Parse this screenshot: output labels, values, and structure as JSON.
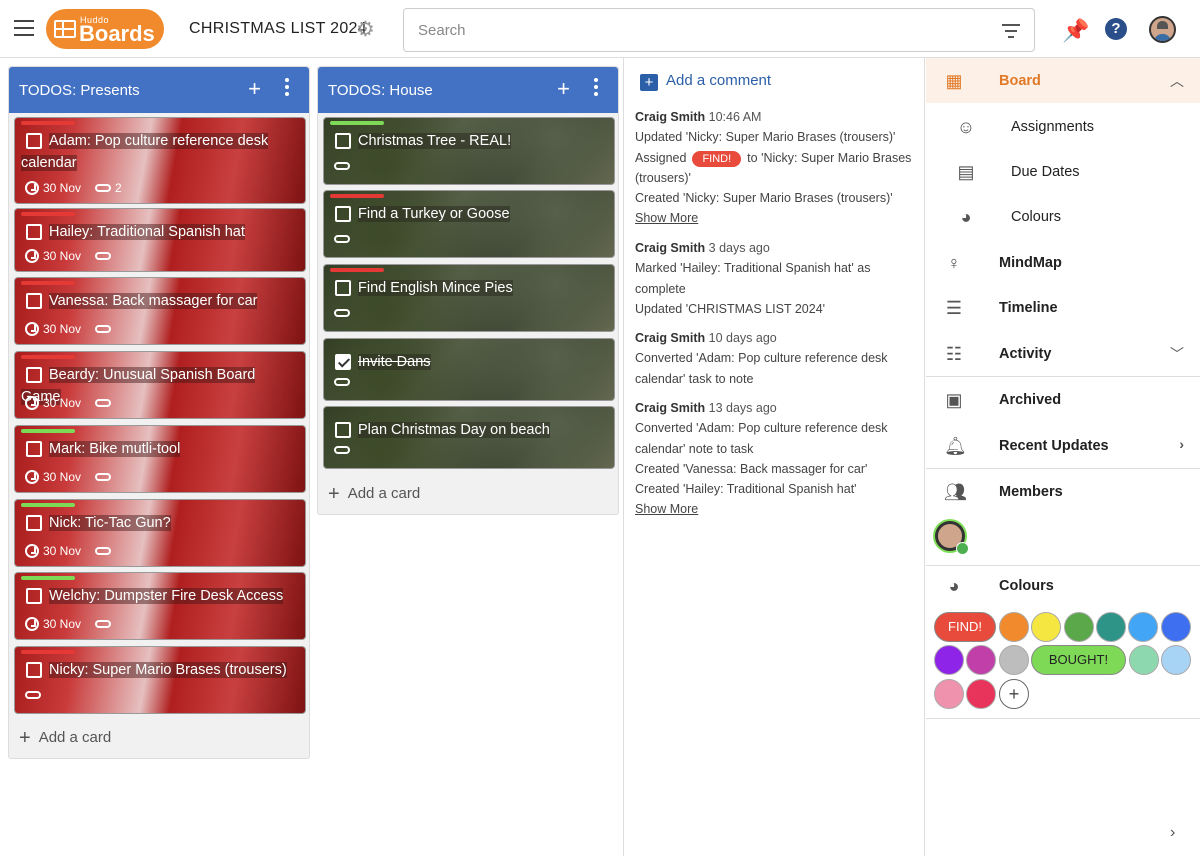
{
  "app": {
    "logo_small": "Huddo",
    "logo_big": "Boards",
    "board_title": "CHRISTMAS LIST 2024"
  },
  "search": {
    "placeholder": "Search"
  },
  "lists": [
    {
      "title": "TODOS: Presents",
      "add_card_label": "Add a card",
      "cards": [
        {
          "title": "Adam: Pop culture reference desk calendar",
          "tag_color": "#e53935",
          "due": "30 Nov",
          "links": "2",
          "checked": false
        },
        {
          "title": "Hailey: Traditional Spanish hat",
          "tag_color": "#e53935",
          "due": "30 Nov",
          "links": "",
          "checked": false
        },
        {
          "title": "Vanessa: Back massager for car",
          "tag_color": "#e53935",
          "due": "30 Nov",
          "links": "",
          "checked": false
        },
        {
          "title": "Beardy: Unusual Spanish Board Game",
          "tag_color": "#e53935",
          "due": "30 Nov",
          "links": "",
          "checked": false
        },
        {
          "title": "Mark: Bike mutli-tool",
          "tag_color": "#7ed957",
          "due": "30 Nov",
          "links": "",
          "checked": false
        },
        {
          "title": "Nick: Tic-Tac Gun?",
          "tag_color": "#7ed957",
          "due": "30 Nov",
          "links": "",
          "checked": false
        },
        {
          "title": "Welchy: Dumpster Fire Desk Access",
          "tag_color": "#7ed957",
          "due": "30 Nov",
          "links": "",
          "checked": false
        },
        {
          "title": "Nicky: Super Mario Brases (trousers)",
          "tag_color": "#e53935",
          "due": "",
          "links": "",
          "checked": false
        }
      ]
    },
    {
      "title": "TODOS: House",
      "add_card_label": "Add a card",
      "cards": [
        {
          "title": "Christmas Tree - REAL!",
          "tag_color": "#7ed957",
          "checked": false
        },
        {
          "title": "Find a Turkey or Goose",
          "tag_color": "#e53935",
          "checked": false
        },
        {
          "title": "Find English Mince Pies",
          "tag_color": "#e53935",
          "checked": false
        },
        {
          "title": "Invite Dans",
          "tag_color": "",
          "checked": true
        },
        {
          "title": "Plan Christmas Day on beach",
          "tag_color": "",
          "checked": false
        }
      ]
    }
  ],
  "comments": {
    "add_label": "Add a comment",
    "entries": [
      {
        "who": "Craig Smith",
        "time": "10:46 AM",
        "lines": [
          "Updated 'Nicky: Super Mario Brases (trousers)'",
          "Assigned",
          "FIND!",
          "to 'Nicky: Super Mario Brases (trousers)'",
          "Created 'Nicky: Super Mario Brases (trousers)'"
        ],
        "more": "Show More"
      },
      {
        "who": "Craig Smith",
        "time": "3 days ago",
        "lines": [
          "Marked 'Hailey: Traditional Spanish hat' as complete",
          "Updated 'CHRISTMAS LIST 2024'"
        ]
      },
      {
        "who": "Craig Smith",
        "time": "10 days ago",
        "lines": [
          "Converted 'Adam: Pop culture reference desk calendar' task to note"
        ]
      },
      {
        "who": "Craig Smith",
        "time": "13 days ago",
        "lines": [
          "Converted 'Adam: Pop culture reference desk calendar' note to task",
          "Created 'Vanessa: Back massager for car'",
          "Created 'Hailey: Traditional Spanish hat'"
        ],
        "more": "Show More"
      }
    ]
  },
  "sidebar": {
    "board": "Board",
    "assignments": "Assignments",
    "due_dates": "Due Dates",
    "colours_sub": "Colours",
    "mindmap": "MindMap",
    "timeline": "Timeline",
    "activity": "Activity",
    "archived": "Archived",
    "recent_updates": "Recent Updates",
    "members": "Members",
    "colours": "Colours",
    "palette": [
      {
        "label": "FIND!",
        "color": "#e84b3c"
      },
      {
        "label": "",
        "color": "#f08a2c"
      },
      {
        "label": "",
        "color": "#f5e642"
      },
      {
        "label": "",
        "color": "#5aa84a"
      },
      {
        "label": "",
        "color": "#2e9487"
      },
      {
        "label": "",
        "color": "#42a5f5"
      },
      {
        "label": "",
        "color": "#3d6ff0"
      },
      {
        "label": "",
        "color": "#8e24e8"
      },
      {
        "label": "",
        "color": "#c13fa8"
      },
      {
        "label": "",
        "color": "#bdbdbd"
      },
      {
        "label": "BOUGHT!",
        "color": "#7ed957"
      },
      {
        "label": "",
        "color": "#8ed8b0"
      },
      {
        "label": "",
        "color": "#a7d3f5"
      },
      {
        "label": "",
        "color": "#ef92ad"
      },
      {
        "label": "",
        "color": "#e8335a"
      }
    ]
  }
}
